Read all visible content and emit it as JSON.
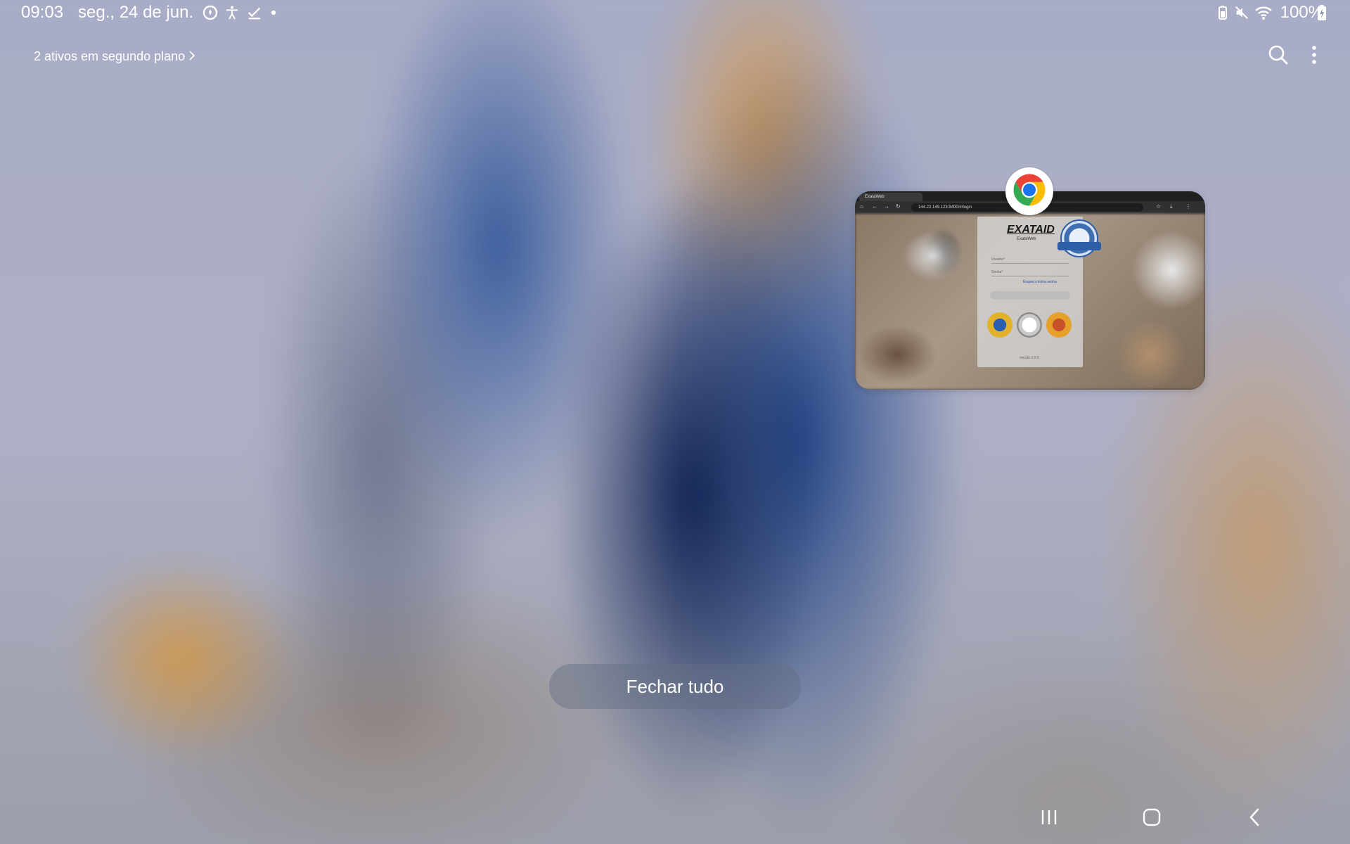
{
  "status_bar": {
    "time": "09:03",
    "date": "seg., 24 de jun.",
    "notification_icons": [
      "activity-ring-icon",
      "accessibility-icon",
      "checkmark-icon",
      "dot-icon"
    ],
    "system_icons": [
      "battery-saver-icon",
      "mute-icon",
      "wifi-icon",
      "battery-charging-icon"
    ],
    "battery_text": "100%"
  },
  "recents": {
    "background_apps_label": "2 ativos em segundo plano",
    "search_icon": "search-icon",
    "more_icon": "more-options-icon",
    "close_all_label": "Fechar tudo"
  },
  "recent_app": {
    "app": "Chrome",
    "icon": "chrome-icon",
    "preview": {
      "tab_title": "ExataWeb",
      "url": "144.22.149.123:8400/#/login",
      "logo": "EXATAID",
      "logo_sub": "ExataWeb",
      "username_placeholder": "Usuário*",
      "password_placeholder": "Senha*",
      "forgot_password": "Esqueci minha senha",
      "login_button": "Entrar",
      "footer": "versão 2.0.0"
    }
  },
  "nav_bar": {
    "recents_icon": "recents-icon",
    "home_icon": "home-icon",
    "back_icon": "back-icon"
  },
  "colors": {
    "text": "#ffffff",
    "close_all_bg": "#6e7890",
    "chrome_red": "#ea4335",
    "chrome_yellow": "#fbbc04",
    "chrome_green": "#34a853",
    "chrome_blue": "#1a73e8"
  }
}
